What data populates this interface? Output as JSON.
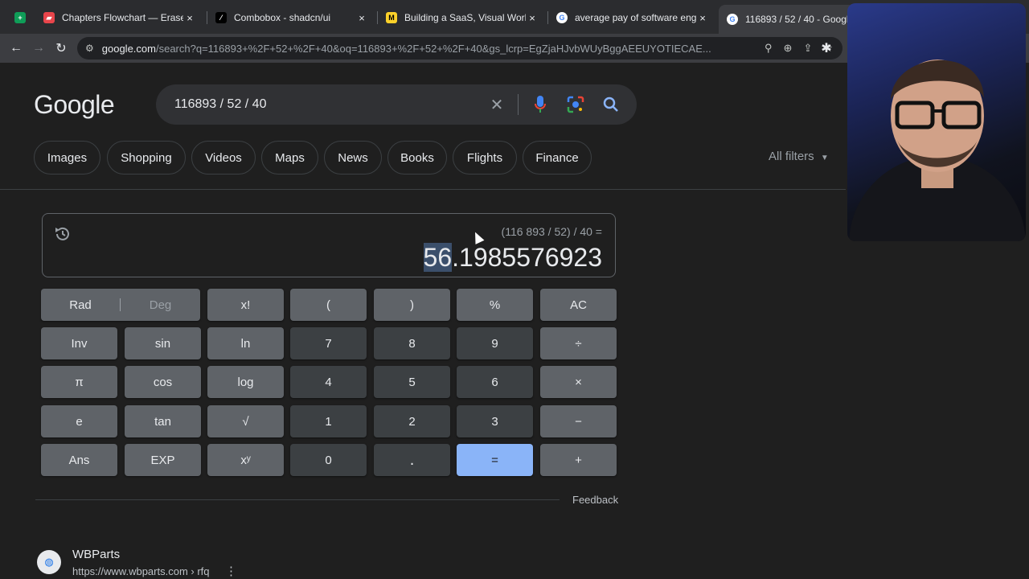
{
  "tabs": [
    {
      "title": "Chapters Flowchart — Eraser",
      "close": "×",
      "favicon": "eraser"
    },
    {
      "title": "Combobox - shadcn/ui",
      "close": "×",
      "favicon": "shadcn"
    },
    {
      "title": "Building a SaaS, Visual Worksp",
      "close": "×",
      "favicon": "miro"
    },
    {
      "title": "average pay of software engin",
      "close": "×",
      "favicon": "google"
    },
    {
      "title": "116893 / 52 / 40 - Google",
      "close": "",
      "favicon": "google"
    }
  ],
  "omnibox": {
    "host": "google.com",
    "path": "/search?q=116893+%2F+52+%2F+40&oq=116893+%2F+52+%2F+40&gs_lcrp=EgZjaHJvbWUyBggAEEUYOTIECAE..."
  },
  "logo": "Google",
  "search": {
    "query": "116893 / 52 / 40"
  },
  "chips": [
    "Images",
    "Shopping",
    "Videos",
    "Maps",
    "News",
    "Books",
    "Flights",
    "Finance"
  ],
  "all_filters": "All filters",
  "calculator": {
    "expression": "(116 893 / 52) / 40 =",
    "result_highlight": "56",
    "result_rest": ".1985576923",
    "rad": "Rad",
    "deg": "Deg",
    "keys": [
      [
        "x!",
        "(",
        ")",
        "%",
        "AC"
      ],
      [
        "Inv",
        "sin",
        "ln",
        "7",
        "8",
        "9",
        "÷"
      ],
      [
        "π",
        "cos",
        "log",
        "4",
        "5",
        "6",
        "×"
      ],
      [
        "e",
        "tan",
        "√",
        "1",
        "2",
        "3",
        "−"
      ],
      [
        "Ans",
        "EXP",
        "xʸ",
        "0",
        ".",
        "=",
        "+"
      ]
    ]
  },
  "feedback": "Feedback",
  "result": {
    "title": "WBParts",
    "url": "https://www.wbparts.com › rfq",
    "more": "⋮"
  },
  "colors": {
    "accent": "#8ab4f8",
    "background": "#1f1f1f"
  }
}
